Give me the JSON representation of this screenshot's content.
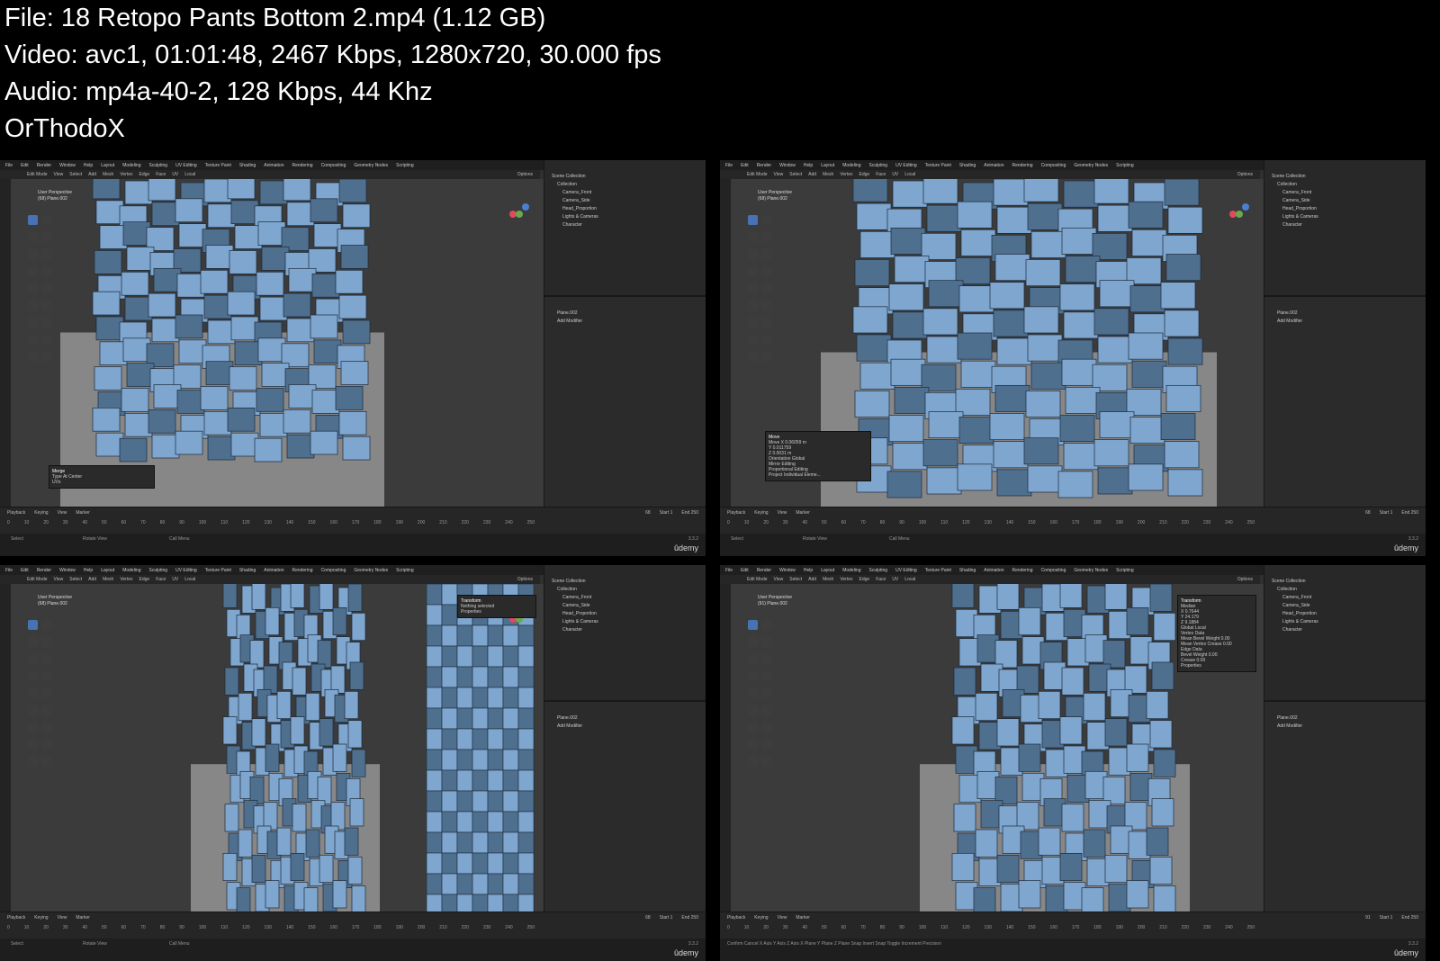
{
  "header": {
    "file_line": "File: 18  Retopo Pants Bottom 2.mp4 (1.12 GB)",
    "video_line": "Video: avc1, 01:01:48, 2467 Kbps, 1280x720, 30.000 fps",
    "audio_line": "Audio: mp4a-40-2, 128 Kbps, 44 Khz",
    "author_line": "OrThodoX"
  },
  "blender": {
    "menu": [
      "File",
      "Edit",
      "Render",
      "Window",
      "Help"
    ],
    "workspaces": [
      "Layout",
      "Modeling",
      "Sculpting",
      "UV Editing",
      "Texture Paint",
      "Shading",
      "Animation",
      "Rendering",
      "Compositing",
      "Geometry Nodes",
      "Scripting"
    ],
    "scene_label": "Scene",
    "view_layer_label": "ViewLayer",
    "mode": "Edit Mode",
    "header_menu": [
      "View",
      "Select",
      "Add",
      "Mesh",
      "Vertex",
      "Edge",
      "Face",
      "UV"
    ],
    "transform_orientation": "Local",
    "options_label": "Options",
    "outliner": [
      "Scene Collection",
      "Collection",
      "Camera_Front",
      "Camera_Side",
      "Head_Proportion",
      "Lights & Cameras",
      "Character"
    ],
    "object_name": "Plane.002",
    "add_modifier": "Add Modifier",
    "timeline_menu": [
      "Playback",
      "Keying",
      "View",
      "Marker"
    ],
    "start_label": "Start",
    "start_value": "1",
    "end_label": "End",
    "end_value": "250",
    "ruler": [
      "0",
      "10",
      "20",
      "30",
      "40",
      "50",
      "60",
      "70",
      "80",
      "90",
      "100",
      "110",
      "120",
      "130",
      "140",
      "150",
      "160",
      "170",
      "180",
      "190",
      "200",
      "210",
      "220",
      "230",
      "240",
      "250"
    ],
    "status": [
      "Select",
      "Rotate View",
      "Call Menu"
    ],
    "version": "3.3.2",
    "watermark": "ûdemy"
  },
  "thumbs": [
    {
      "vp_title": "User Perspective",
      "vp_sub": "(68) Plane.002",
      "frame": "68",
      "panel_title": "Merge",
      "panel_rows": [
        "Type   At Center",
        "UVs"
      ]
    },
    {
      "vp_title": "User Perspective",
      "vp_sub": "(68) Plane.002",
      "frame": "68",
      "panel_title": "Move",
      "panel_rows": [
        "Move X   0.06059 m",
        "Y   0.011759",
        "Z   0.0031 m",
        "Orientation   Global",
        "Mirror Editing",
        "Proportional Editing",
        "Project Individual Eleme..."
      ]
    },
    {
      "vp_title": "User Perspective",
      "vp_sub": "(68) Plane.002",
      "frame": "68",
      "panel_title": "Transform",
      "panel_rows": [
        "Nothing selected",
        "Properties"
      ]
    },
    {
      "vp_title": "User Perspective",
      "vp_sub": "(91) Plane.002",
      "frame": "91",
      "panel_title": "Transform",
      "panel_rows": [
        "Median",
        "X   0.7644",
        "Y   24.179",
        "Z   9.1884",
        "Global   Local",
        "Vertex Data",
        "Mean Bevel Weight   0.00",
        "Mean Vertex Crease   0.00",
        "Edge Data",
        "Bevel Weight   0.00",
        "Crease   0.00",
        "Properties"
      ],
      "status_extra": "Confirm   Cancel   X Axis   Y Axis   Z Axis   X Plane   Y Plane   Z Plane   Snap Invert   Snap Toggle   Increment   Precision"
    }
  ],
  "colors": {
    "mesh_blue": "#7ea6cf",
    "mesh_blue_dark": "#4f6f8f",
    "sculpt": "#9b9b9b",
    "viewport": "#3b3b3b",
    "ui": "#282828",
    "active": "#4772b3"
  }
}
